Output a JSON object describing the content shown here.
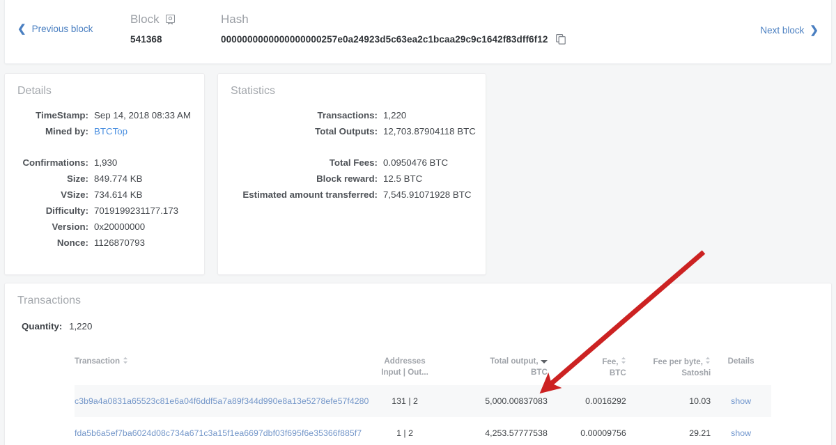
{
  "header": {
    "prev_block_label": "Previous block",
    "next_block_label": "Next block",
    "block_label": "Block",
    "block_value": "541368",
    "hash_label": "Hash",
    "hash_value": "0000000000000000000257e0a24923d5c63ea2c1bcaa29c9c1642f83dff6f12",
    "block_icon": "block-ribbon-icon",
    "copy_icon": "copy-icon",
    "prev_icon": "chevron-left-icon",
    "next_icon": "chevron-right-icon"
  },
  "details": {
    "title": "Details",
    "rows": [
      {
        "key": "TimeStamp:",
        "value": "Sep 14, 2018 08:33 AM",
        "link": false
      },
      {
        "key": "Mined by:",
        "value": "BTCTop",
        "link": true
      }
    ],
    "rows2": [
      {
        "key": "Confirmations:",
        "value": "1,930"
      },
      {
        "key": "Size:",
        "value": "849.774 KB"
      },
      {
        "key": "VSize:",
        "value": "734.614 KB"
      },
      {
        "key": "Difficulty:",
        "value": "7019199231177.173"
      },
      {
        "key": "Version:",
        "value": "0x20000000"
      },
      {
        "key": "Nonce:",
        "value": "1126870793"
      }
    ]
  },
  "statistics": {
    "title": "Statistics",
    "rows": [
      {
        "key": "Transactions:",
        "value": "1,220"
      },
      {
        "key": "Total Outputs:",
        "value": "12,703.87904118 BTC"
      }
    ],
    "rows2": [
      {
        "key": "Total Fees:",
        "value": "0.0950476 BTC"
      },
      {
        "key": "Block reward:",
        "value": "12.5 BTC"
      },
      {
        "key": "Estimated amount transferred:",
        "value": "7,545.91071928 BTC"
      }
    ]
  },
  "transactions": {
    "title": "Transactions",
    "quantity_label": "Quantity:",
    "quantity_value": "1,220",
    "columns": {
      "transaction": "Transaction",
      "addresses_l1": "Addresses",
      "addresses_l2": "Input | Out...",
      "total_output_l1": "Total output,",
      "total_output_l2": "BTC",
      "fee_l1": "Fee,",
      "fee_l2": "BTC",
      "fee_per_byte_l1": "Fee per byte,",
      "fee_per_byte_l2": "Satoshi",
      "details": "Details"
    },
    "rows": [
      {
        "hash": "c3b9a4a0831a65523c81e6a04f6ddf5a7a89f344d990e8a13e5278efe57f4280",
        "addresses": "131 | 2",
        "total_output": "5,000.00837083",
        "fee": "0.0016292",
        "fee_per_byte": "10.03",
        "details": "show"
      },
      {
        "hash": "fda5b6a5ef7ba6024d08c734a671c3a15f1ea6697dbf03f695f6e35366f885f7",
        "addresses": "1 | 2",
        "total_output": "4,253.57777538",
        "fee": "0.00009756",
        "fee_per_byte": "29.21",
        "details": "show"
      }
    ]
  },
  "annotation": {
    "arrow_color": "#cc2222",
    "arrow_name": "red-pointer-arrow"
  },
  "colors": {
    "page_background": "#f5f6f7",
    "card_background": "#ffffff",
    "link": "#4a8fe0",
    "muted_title": "#a4a8ad",
    "text": "#3f4347",
    "row_alt": "#f7f8f9"
  }
}
